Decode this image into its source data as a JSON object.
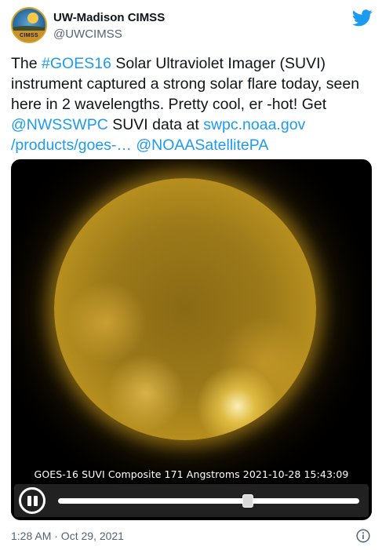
{
  "author": {
    "display_name": "UW-Madison CIMSS",
    "handle": "@UWCIMSS",
    "avatar_text": "CIMSS"
  },
  "tweet": {
    "segments": [
      {
        "text": "The ",
        "link": false
      },
      {
        "text": "#GOES16",
        "link": true
      },
      {
        "text": " Solar Ultraviolet Imager (SUVI) instrument captured a strong solar flare today, seen here in 2 wavelengths. Pretty cool, er -hot! Get ",
        "link": false
      },
      {
        "text": "@NWSSWPC",
        "link": true
      },
      {
        "text": " SUVI data at ",
        "link": false
      },
      {
        "text": "swpc.noaa.gov /products/goes-…",
        "link": true
      },
      {
        "text": " ",
        "link": false
      },
      {
        "text": "@NOAASatellitePA",
        "link": true
      }
    ]
  },
  "media": {
    "caption": "GOES-16 SUVI Composite 171 Angstroms 2021-10-28 15:43:09",
    "playback_progress": 0.63,
    "controls": {
      "pause_icon": "pause-icon"
    }
  },
  "footer": {
    "time": "1:28 AM · Oct 29, 2021",
    "info_icon": "info-icon"
  },
  "colors": {
    "link": "#1d9bf0",
    "twitter_blue": "#1d9bf0",
    "secondary_text": "#536471"
  }
}
